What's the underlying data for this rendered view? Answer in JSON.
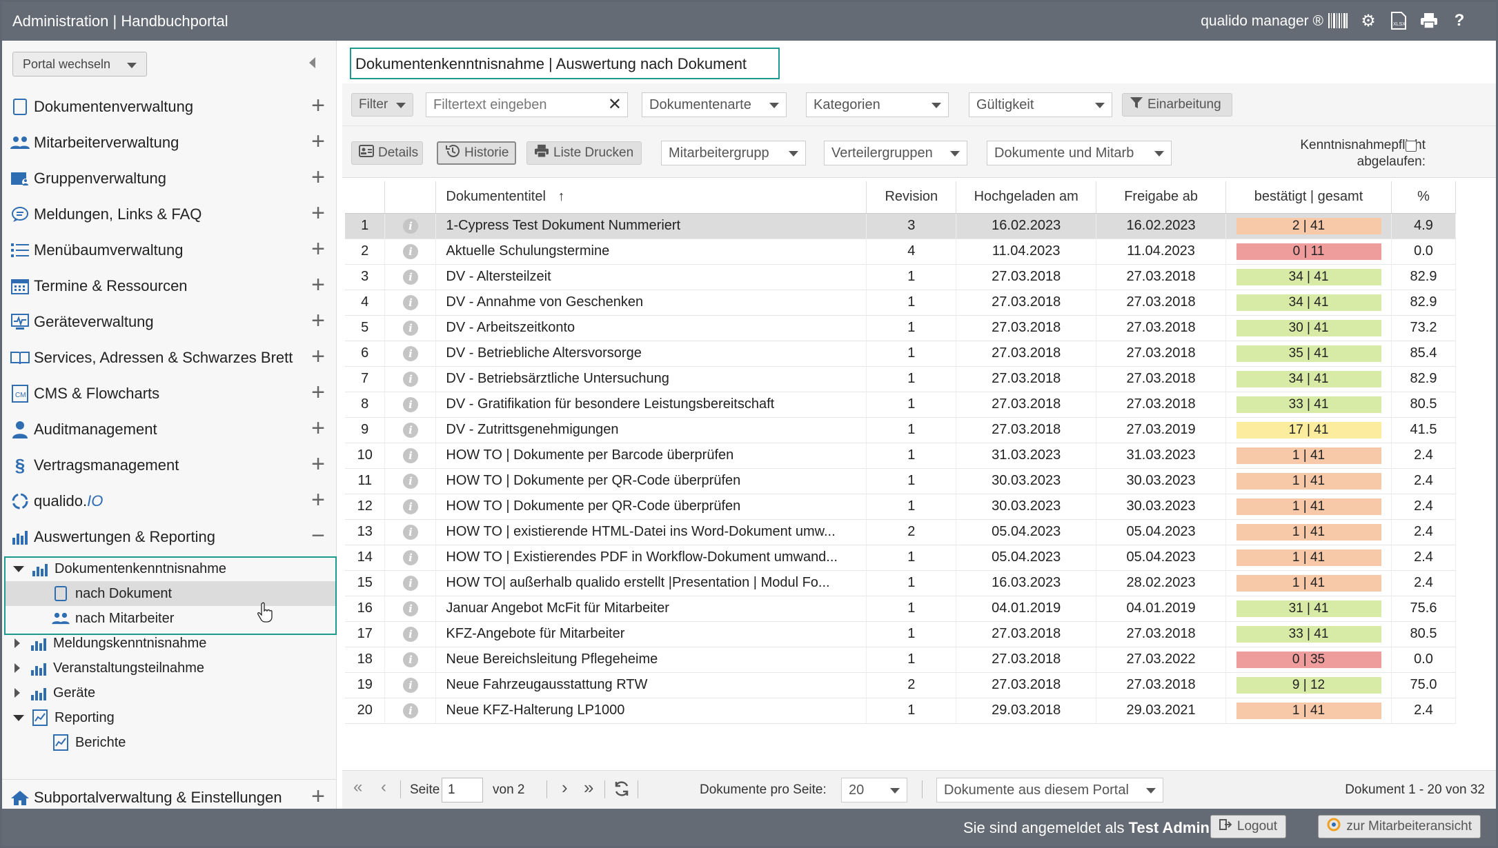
{
  "header": {
    "title": "Administration | Handbuchportal",
    "brand": "qualido manager ®",
    "tools": [
      "barcode-icon",
      "cogs-icon",
      "xlsx-icon",
      "print-icon",
      "help-icon"
    ]
  },
  "sidebar": {
    "portal_switch": "Portal wechseln",
    "items": [
      {
        "label": "Dokumentenverwaltung",
        "icon": "document-icon"
      },
      {
        "label": "Mitarbeiterverwaltung",
        "icon": "users-icon"
      },
      {
        "label": "Gruppenverwaltung",
        "icon": "group-icon"
      },
      {
        "label": "Meldungen, Links & FAQ",
        "icon": "speech-bubble-icon"
      },
      {
        "label": "Menübaumverwaltung",
        "icon": "list-icon"
      },
      {
        "label": "Termine & Ressourcen",
        "icon": "calendar-icon"
      },
      {
        "label": "Geräteverwaltung",
        "icon": "monitor-icon"
      },
      {
        "label": "Services, Adressen & Schwarzes Brett",
        "icon": "book-icon"
      },
      {
        "label": "CMS & Flowcharts",
        "icon": "cms-icon"
      },
      {
        "label": "Auditmanagement",
        "icon": "auditor-icon"
      },
      {
        "label": "Vertragsmanagement",
        "icon": "paragraph-icon"
      },
      {
        "label": "qualido.IO",
        "icon": "io-icon"
      },
      {
        "label": "Auswertungen & Reporting",
        "icon": "bar-chart-icon"
      }
    ],
    "tree": {
      "dokumentenkenntnisnahme": "Dokumentenkenntnisnahme",
      "nach_dokument": "nach Dokument",
      "nach_mitarbeiter": "nach Mitarbeiter",
      "meldungskenntnisnahme": "Meldungskenntnisnahme",
      "veranstaltungsteilnahme": "Veranstaltungsteilnahme",
      "geraete": "Geräte",
      "reporting": "Reporting",
      "berichte": "Berichte"
    },
    "bottom_item": "Subportalverwaltung & Einstellungen"
  },
  "main": {
    "page_title": "Dokumentenkenntnisnahme | Auswertung nach Dokument",
    "filter": {
      "filter_label": "Filter",
      "filter_placeholder": "Filtertext eingeben",
      "dokumentenarten": "Dokumentenarte",
      "kategorien": "Kategorien",
      "gueltigkeit": "Gültigkeit",
      "einarbeitung": "Einarbeitung"
    },
    "tools": {
      "details": "Details",
      "historie": "Historie",
      "liste_drucken": "Liste Drucken",
      "mitarbeitergruppen": "Mitarbeitergrupp",
      "verteilergruppen": "Verteilergruppen",
      "dokumente_mitarb": "Dokumente und Mitarb",
      "kenntnis_line1": "Kenntnisnahmepflicht",
      "kenntnis_line2": "abgelaufen:"
    },
    "columns": [
      "Dokumententitel",
      "Revision",
      "Hochgeladen am",
      "Freigabe ab",
      "bestätigt | gesamt",
      "%"
    ],
    "rows": [
      {
        "n": "1",
        "title": "1-Cypress Test Dokument Nummeriert",
        "rev": "3",
        "up": "16.02.2023",
        "rel": "16.02.2023",
        "conf": "2 | 41",
        "pct": "4.9",
        "color": "#f8c9a8"
      },
      {
        "n": "2",
        "title": "Aktuelle Schulungstermine",
        "rev": "4",
        "up": "11.04.2023",
        "rel": "11.04.2023",
        "conf": "0 | 11",
        "pct": "0.0",
        "color": "#ef9c9c"
      },
      {
        "n": "3",
        "title": "DV - Altersteilzeit",
        "rev": "1",
        "up": "27.03.2018",
        "rel": "27.03.2018",
        "conf": "34 | 41",
        "pct": "82.9",
        "color": "#d8eba6"
      },
      {
        "n": "4",
        "title": "DV - Annahme von Geschenken",
        "rev": "1",
        "up": "27.03.2018",
        "rel": "27.03.2018",
        "conf": "34 | 41",
        "pct": "82.9",
        "color": "#d8eba6"
      },
      {
        "n": "5",
        "title": "DV - Arbeitszeitkonto",
        "rev": "1",
        "up": "27.03.2018",
        "rel": "27.03.2018",
        "conf": "30 | 41",
        "pct": "73.2",
        "color": "#d8eba6"
      },
      {
        "n": "6",
        "title": "DV - Betriebliche Altersvorsorge",
        "rev": "1",
        "up": "27.03.2018",
        "rel": "27.03.2018",
        "conf": "35 | 41",
        "pct": "85.4",
        "color": "#d8eba6"
      },
      {
        "n": "7",
        "title": "DV - Betriebsärztliche Untersuchung",
        "rev": "1",
        "up": "27.03.2018",
        "rel": "27.03.2018",
        "conf": "34 | 41",
        "pct": "82.9",
        "color": "#d8eba6"
      },
      {
        "n": "8",
        "title": "DV - Gratifikation für besondere Leistungsbereitschaft",
        "rev": "1",
        "up": "27.03.2018",
        "rel": "27.03.2018",
        "conf": "33 | 41",
        "pct": "80.5",
        "color": "#d8eba6"
      },
      {
        "n": "9",
        "title": "DV - Zutrittsgenehmigungen",
        "rev": "1",
        "up": "27.03.2018",
        "rel": "27.03.2019",
        "conf": "17 | 41",
        "pct": "41.5",
        "color": "#fbec9e"
      },
      {
        "n": "10",
        "title": "HOW TO | Dokumente per Barcode überprüfen",
        "rev": "1",
        "up": "31.03.2023",
        "rel": "31.03.2023",
        "conf": "1 | 41",
        "pct": "2.4",
        "color": "#f8c9a8"
      },
      {
        "n": "11",
        "title": "HOW TO | Dokumente per QR-Code überprüfen",
        "rev": "1",
        "up": "30.03.2023",
        "rel": "30.03.2023",
        "conf": "1 | 41",
        "pct": "2.4",
        "color": "#f8c9a8"
      },
      {
        "n": "12",
        "title": "HOW TO | Dokumente per QR-Code überprüfen",
        "rev": "1",
        "up": "30.03.2023",
        "rel": "30.03.2023",
        "conf": "1 | 41",
        "pct": "2.4",
        "color": "#f8c9a8"
      },
      {
        "n": "13",
        "title": "HOW TO | existierende HTML-Datei ins Word-Dokument umw...",
        "rev": "2",
        "up": "05.04.2023",
        "rel": "05.04.2023",
        "conf": "1 | 41",
        "pct": "2.4",
        "color": "#f8c9a8"
      },
      {
        "n": "14",
        "title": "HOW TO | Existierendes PDF in Workflow-Dokument umwand...",
        "rev": "1",
        "up": "05.04.2023",
        "rel": "05.04.2023",
        "conf": "1 | 41",
        "pct": "2.4",
        "color": "#f8c9a8"
      },
      {
        "n": "15",
        "title": "HOW TO| außerhalb qualido erstellt |Presentation | Modul Fo...",
        "rev": "1",
        "up": "16.03.2023",
        "rel": "28.02.2023",
        "conf": "1 | 41",
        "pct": "2.4",
        "color": "#f8c9a8"
      },
      {
        "n": "16",
        "title": "Januar Angebot McFit für Mitarbeiter",
        "rev": "1",
        "up": "04.01.2019",
        "rel": "04.01.2019",
        "conf": "31 | 41",
        "pct": "75.6",
        "color": "#d8eba6"
      },
      {
        "n": "17",
        "title": "KFZ-Angebote für Mitarbeiter",
        "rev": "1",
        "up": "27.03.2018",
        "rel": "27.03.2018",
        "conf": "33 | 41",
        "pct": "80.5",
        "color": "#d8eba6"
      },
      {
        "n": "18",
        "title": "Neue Bereichsleitung Pflegeheime",
        "rev": "1",
        "up": "27.03.2018",
        "rel": "27.03.2022",
        "conf": "0 | 35",
        "pct": "0.0",
        "color": "#ef9c9c"
      },
      {
        "n": "19",
        "title": "Neue Fahrzeugausstattung RTW",
        "rev": "2",
        "up": "27.03.2018",
        "rel": "27.03.2018",
        "conf": "9 | 12",
        "pct": "75.0",
        "color": "#d8eba6"
      },
      {
        "n": "20",
        "title": "Neue KFZ-Halterung LP1000",
        "rev": "1",
        "up": "29.03.2018",
        "rel": "29.03.2021",
        "conf": "1 | 41",
        "pct": "2.4",
        "color": "#f8c9a8"
      }
    ],
    "pager": {
      "seite_label": "Seite",
      "page": "1",
      "von": "von 2",
      "per_page_label": "Dokumente pro Seite:",
      "per_page": "20",
      "scope": "Dokumente aus diesem Portal",
      "summary": "Dokument 1 - 20 von 32"
    }
  },
  "footer": {
    "logged_in_prefix": "Sie sind angemeldet als",
    "user": "Test Admin",
    "logout": "Logout",
    "employee_view": "zur Mitarbeiteransicht"
  }
}
